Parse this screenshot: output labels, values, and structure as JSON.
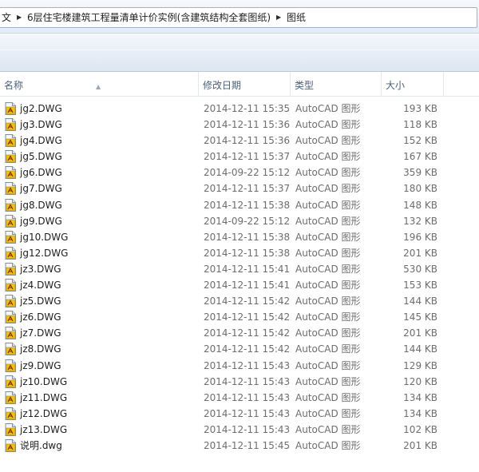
{
  "address": {
    "crumbs": [
      "文",
      "6层住宅楼建筑工程量清单计价实例(含建筑结构全套图纸)",
      "图纸"
    ]
  },
  "columns": {
    "name": "名称",
    "date": "修改日期",
    "type": "类型",
    "size": "大小"
  },
  "icons": {
    "file": "autocad-file-icon",
    "breadcrumb_separator": "chevron-right-icon",
    "sort": "sort-up-icon"
  },
  "files": [
    {
      "name": "jg2.DWG",
      "date": "2014-12-11 15:35",
      "type": "AutoCAD 图形",
      "size": "193 KB"
    },
    {
      "name": "jg3.DWG",
      "date": "2014-12-11 15:36",
      "type": "AutoCAD 图形",
      "size": "118 KB"
    },
    {
      "name": "jg4.DWG",
      "date": "2014-12-11 15:36",
      "type": "AutoCAD 图形",
      "size": "152 KB"
    },
    {
      "name": "jg5.DWG",
      "date": "2014-12-11 15:37",
      "type": "AutoCAD 图形",
      "size": "167 KB"
    },
    {
      "name": "jg6.DWG",
      "date": "2014-09-22 15:12",
      "type": "AutoCAD 图形",
      "size": "359 KB"
    },
    {
      "name": "jg7.DWG",
      "date": "2014-12-11 15:37",
      "type": "AutoCAD 图形",
      "size": "180 KB"
    },
    {
      "name": "jg8.DWG",
      "date": "2014-12-11 15:38",
      "type": "AutoCAD 图形",
      "size": "148 KB"
    },
    {
      "name": "jg9.DWG",
      "date": "2014-09-22 15:12",
      "type": "AutoCAD 图形",
      "size": "132 KB"
    },
    {
      "name": "jg10.DWG",
      "date": "2014-12-11 15:38",
      "type": "AutoCAD 图形",
      "size": "196 KB"
    },
    {
      "name": "jg12.DWG",
      "date": "2014-12-11 15:38",
      "type": "AutoCAD 图形",
      "size": "201 KB"
    },
    {
      "name": "jz3.DWG",
      "date": "2014-12-11 15:41",
      "type": "AutoCAD 图形",
      "size": "530 KB"
    },
    {
      "name": "jz4.DWG",
      "date": "2014-12-11 15:41",
      "type": "AutoCAD 图形",
      "size": "153 KB"
    },
    {
      "name": "jz5.DWG",
      "date": "2014-12-11 15:42",
      "type": "AutoCAD 图形",
      "size": "144 KB"
    },
    {
      "name": "jz6.DWG",
      "date": "2014-12-11 15:42",
      "type": "AutoCAD 图形",
      "size": "145 KB"
    },
    {
      "name": "jz7.DWG",
      "date": "2014-12-11 15:42",
      "type": "AutoCAD 图形",
      "size": "201 KB"
    },
    {
      "name": "jz8.DWG",
      "date": "2014-12-11 15:42",
      "type": "AutoCAD 图形",
      "size": "144 KB"
    },
    {
      "name": "jz9.DWG",
      "date": "2014-12-11 15:43",
      "type": "AutoCAD 图形",
      "size": "129 KB"
    },
    {
      "name": "jz10.DWG",
      "date": "2014-12-11 15:43",
      "type": "AutoCAD 图形",
      "size": "120 KB"
    },
    {
      "name": "jz11.DWG",
      "date": "2014-12-11 15:43",
      "type": "AutoCAD 图形",
      "size": "134 KB"
    },
    {
      "name": "jz12.DWG",
      "date": "2014-12-11 15:43",
      "type": "AutoCAD 图形",
      "size": "134 KB"
    },
    {
      "name": "jz13.DWG",
      "date": "2014-12-11 15:43",
      "type": "AutoCAD 图形",
      "size": "102 KB"
    },
    {
      "name": "说明.dwg",
      "date": "2014-12-11 15:45",
      "type": "AutoCAD 图形",
      "size": "201 KB"
    }
  ]
}
